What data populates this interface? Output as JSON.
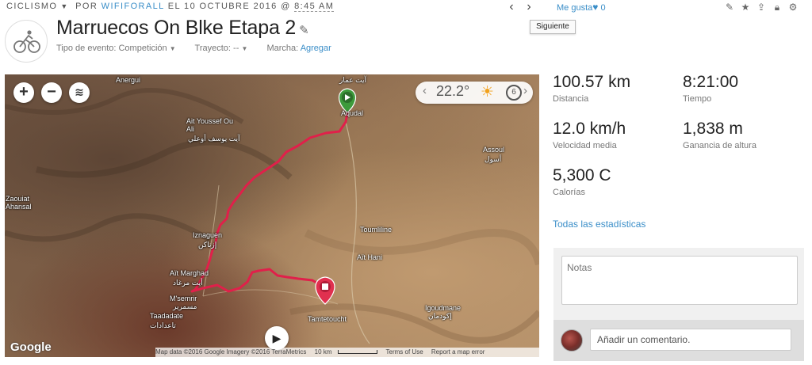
{
  "breadcrumb": {
    "activity_type": "CICLISMO",
    "by": "POR",
    "author": "WIFIFORALL",
    "date": "EL 10 OCTUBRE 2016 @",
    "time": "8:45 AM"
  },
  "nav": {
    "prev_icon": "chevron-left-icon",
    "next_icon": "chevron-right-icon",
    "tooltip": "Siguiente"
  },
  "like": {
    "label": "Me gusta",
    "count": "0"
  },
  "tools": [
    "pencil-icon",
    "star-icon",
    "share-icon",
    "lock-icon",
    "gear-icon"
  ],
  "header": {
    "title": "Marruecos On Blke Etapa 2",
    "event_label": "Tipo de evento:",
    "event_value": "Competición",
    "route_label": "Trayecto:",
    "route_value": "--",
    "march_label": "Marcha:",
    "march_value": "Agregar"
  },
  "map": {
    "weather": {
      "temp": "22.2°",
      "badge": "6"
    },
    "places": [
      "Anergui",
      "آيت عمار",
      "Aqudal",
      "Ait Youssef Ou Ali",
      "آيت يوسف أوعلي",
      "Assoul",
      "أسول",
      "Zaouiat Ahansal",
      "Iznaguen",
      "إزناكن",
      "Toumliline",
      "Aït Hani",
      "Aït Marghad",
      "أيت مرغاد",
      "M'semrir",
      "مسمرير",
      "Taadadate",
      "تاعدادات",
      "Tamtetoucht",
      "Igoudmane",
      "إكودمان"
    ],
    "google": "Google",
    "attribution": "Map data ©2016 Google Imagery ©2016 TerraMetrics",
    "scale": "10 km",
    "terms": "Terms of Use",
    "report": "Report a map error",
    "route_color": "#e0204a",
    "start_color": "#3d9a3b",
    "end_color": "#e0304f"
  },
  "stats": {
    "distance": {
      "value": "100.57 km",
      "label": "Distancia"
    },
    "time": {
      "value": "8:21:00",
      "label": "Tiempo"
    },
    "avg_speed": {
      "value": "12.0 km/h",
      "label": "Velocidad media"
    },
    "elevation": {
      "value": "1,838 m",
      "label": "Ganancia de altura"
    },
    "calories": {
      "value": "5,300 C",
      "label": "Calorías"
    },
    "all_link": "Todas las estadísticas"
  },
  "notes": {
    "placeholder": "Notas"
  },
  "comment": {
    "placeholder": "Añadir un comentario."
  }
}
